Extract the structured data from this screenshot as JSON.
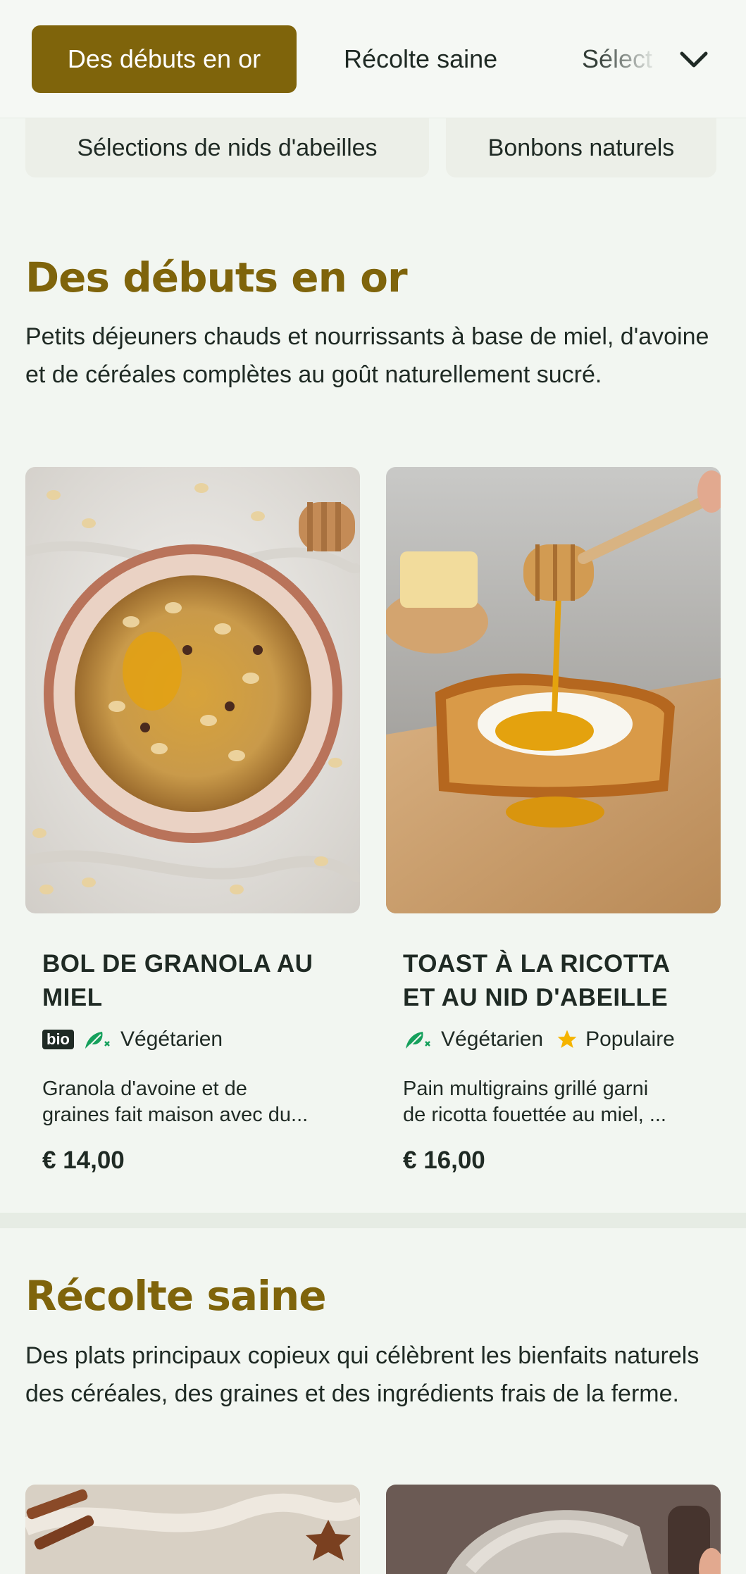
{
  "nav": {
    "tabs": [
      "Des débuts en or",
      "Récolte saine",
      "Sélect"
    ],
    "active_index": 0
  },
  "chips": [
    "Sélections de nids d'abeilles",
    "Bonbons naturels"
  ],
  "sections": [
    {
      "title": "Des débuts en or",
      "description": "Petits déjeuners chauds et nourrissants à base de miel, d'avoine et de céréales complètes au goût naturellement sucré.",
      "items": [
        {
          "name_lines": [
            "BOL DE GRANOLA AU",
            "MIEL"
          ],
          "tags": [
            "bio",
            "Végétarien"
          ],
          "desc_lines": [
            "Granola d'avoine et de",
            "graines fait maison avec du..."
          ],
          "price": "€ 14,00"
        },
        {
          "name_lines": [
            "TOAST À LA RICOTTA",
            "ET AU NID D'ABEILLE"
          ],
          "tags": [
            "Végétarien",
            "Populaire"
          ],
          "desc_lines": [
            "Pain multigrains grillé garni",
            "de ricotta fouettée au miel, ..."
          ],
          "price": "€ 16,00"
        }
      ]
    },
    {
      "title": "Récolte saine",
      "description": "Des plats principaux copieux qui célèbrent les bienfaits naturels des céréales, des graines et des ingrédients frais de la ferme."
    }
  ],
  "colors": {
    "accent": "#7f640b",
    "background": "#f2f6f1",
    "veg_green": "#15a05c",
    "star": "#f5b400"
  },
  "icons": [
    "chevron-down-icon",
    "vegetarian-icon",
    "star-icon"
  ]
}
